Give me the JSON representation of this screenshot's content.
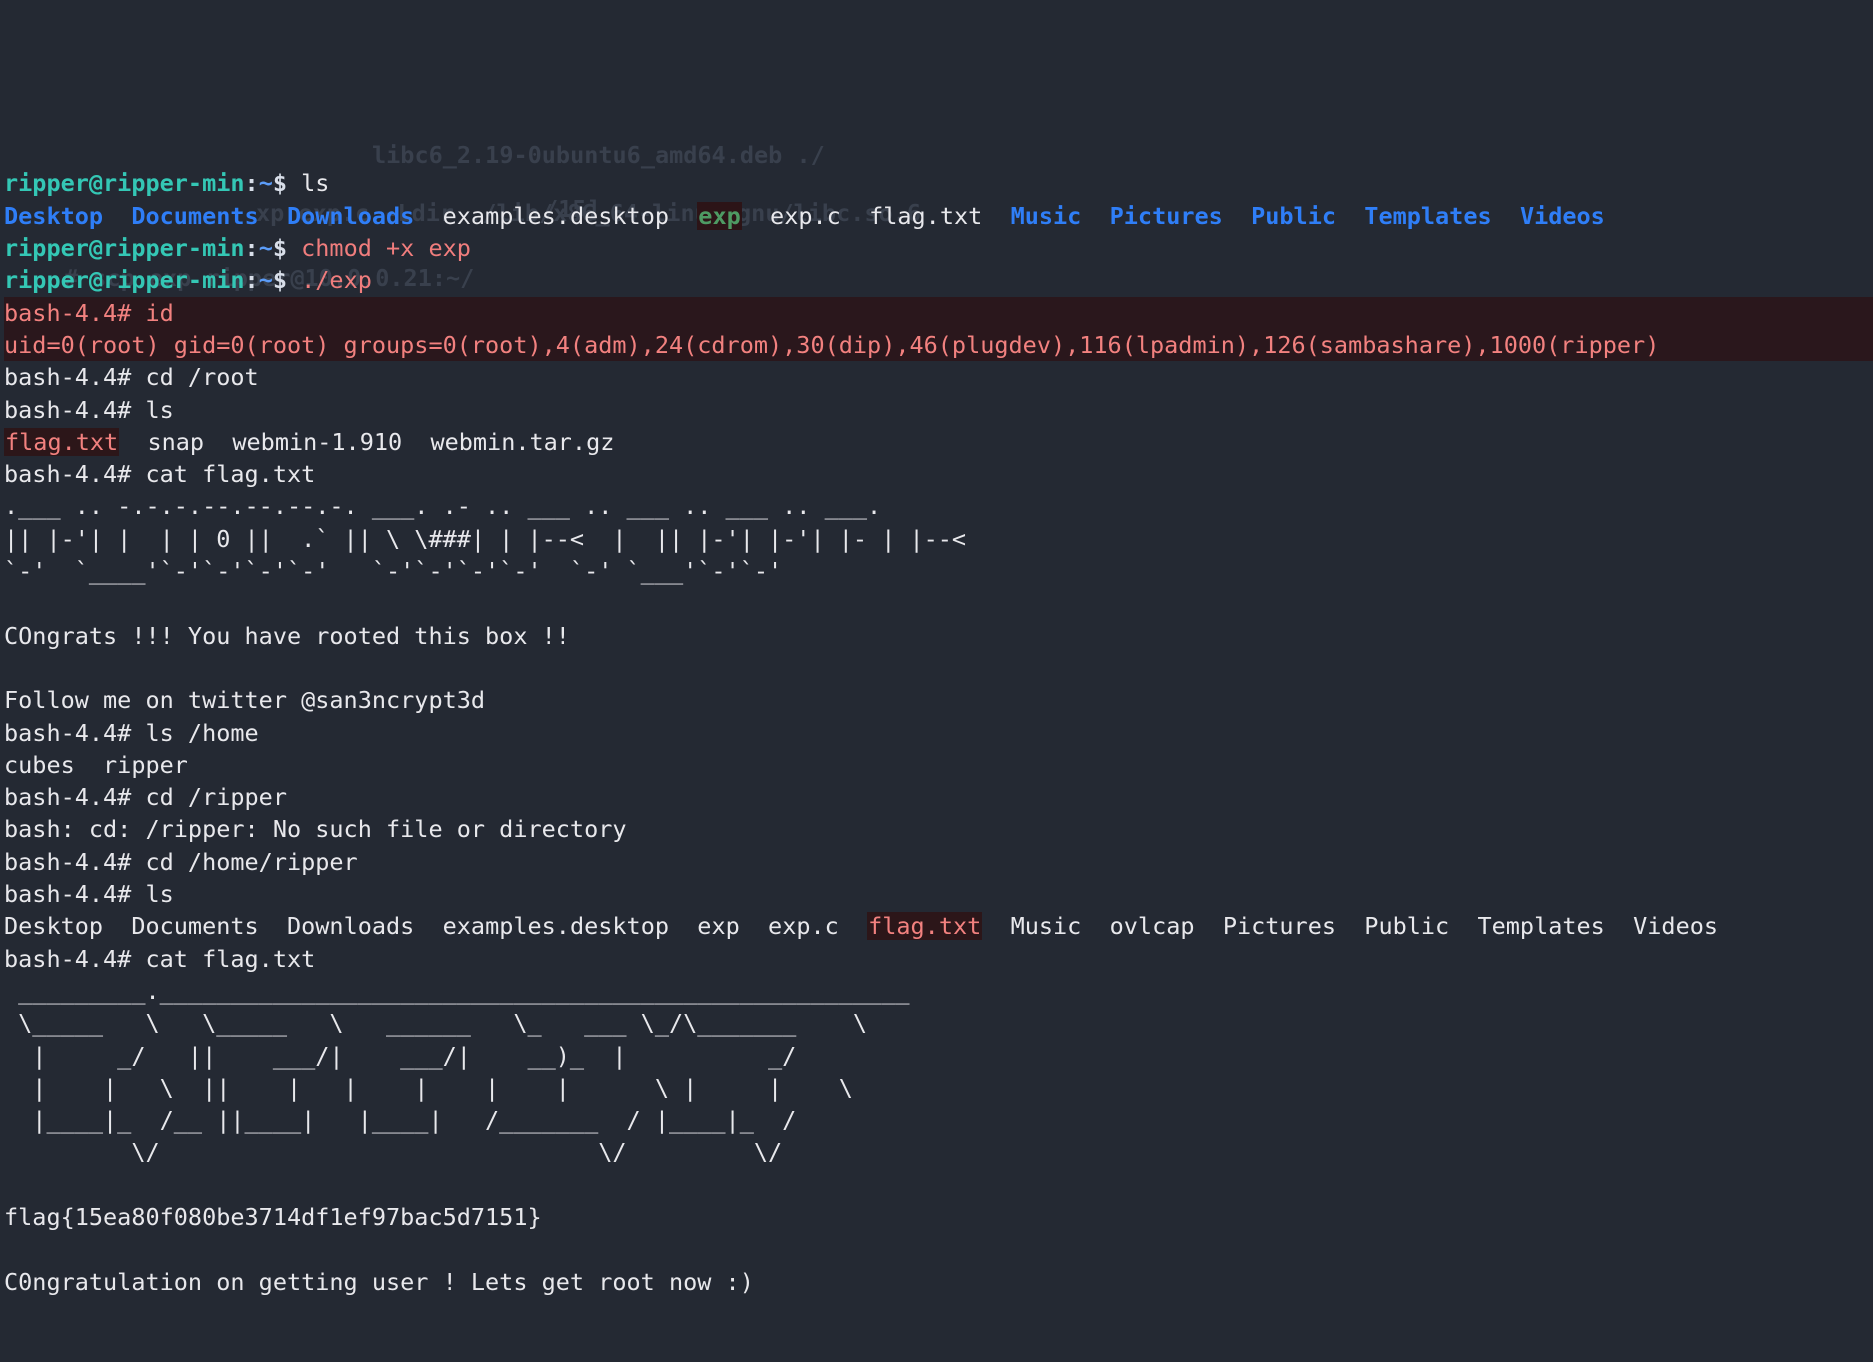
{
  "terminal": {
    "title": "ripper@ripper-min: ~",
    "colors": {
      "background": "#242933",
      "foreground": "#e8e8ec",
      "prompt_user": "#34c7b5",
      "prompt_path": "#5b9cf8",
      "directory": "#2f7ef7",
      "executable_fg": "#4e9a63",
      "executable_bg": "#2c1417",
      "archive_fg": "#f2817f",
      "archive_bg": "#2c1619",
      "root_block_bg": "#2a171c",
      "root_block_fg": "#f2817f",
      "ghost_text": "#39404d"
    },
    "prompts": {
      "user_prompt": "ripper@ripper-min",
      "user_path": "~",
      "user_sigil": "$",
      "root_prompt": "bash-4.4#"
    },
    "ghost_lines": [
      "",
      "libc6_2.19-0ubuntu6_amd64.deb ./",
      "",
      "/15]",
      "xp exp.c -Ldir ./lib/x86_64-linux-gnu/libc.so.6",
      "",
      "# scp exp ripper@10.0.0.21:~/",
      "0.0.21"
    ],
    "session": [
      {
        "type": "prompt-user",
        "command": "ls"
      },
      {
        "type": "ls-output",
        "entries": [
          {
            "name": "Desktop",
            "style": "dir"
          },
          {
            "name": "Documents",
            "style": "dir"
          },
          {
            "name": "Downloads",
            "style": "dir"
          },
          {
            "name": "examples.desktop",
            "style": "plain"
          },
          {
            "name": "exp",
            "style": "exe"
          },
          {
            "name": "exp.c",
            "style": "plain"
          },
          {
            "name": "flag.txt",
            "style": "plain"
          },
          {
            "name": "Music",
            "style": "dir"
          },
          {
            "name": "Pictures",
            "style": "dir"
          },
          {
            "name": "Public",
            "style": "dir"
          },
          {
            "name": "Templates",
            "style": "dir"
          },
          {
            "name": "Videos",
            "style": "dir"
          }
        ]
      },
      {
        "type": "prompt-user",
        "command": "chmod +x exp"
      },
      {
        "type": "prompt-user",
        "command": "./exp"
      },
      {
        "type": "root-cmd-hl",
        "command": "id"
      },
      {
        "type": "root-out-hl",
        "text": "uid=0(root) gid=0(root) groups=0(root),4(adm),24(cdrom),30(dip),46(plugdev),116(lpadmin),126(sambashare),1000(ripper)"
      },
      {
        "type": "root-cmd",
        "command": "cd /root"
      },
      {
        "type": "root-cmd",
        "command": "ls"
      },
      {
        "type": "ls-output",
        "entries": [
          {
            "name": "flag.txt",
            "style": "hl-file"
          },
          {
            "name": "snap",
            "style": "plain"
          },
          {
            "name": "webmin-1.910",
            "style": "plain"
          },
          {
            "name": "webmin.tar.gz",
            "style": "plain"
          }
        ]
      },
      {
        "type": "root-cmd",
        "command": "cat flag.txt"
      },
      {
        "type": "art",
        "lines": [
          ".___ .. -.-.-.--.--.--.-. ___. .- .. ___ .. ___ .. ___ .. ___.",
          "|| |-'| |  | | 0 ||  .` || \\ \\###| | |--<  |  || |-'| |-'| |- | |--<",
          "`-'  `____'`-'`-'`-'`-'   `-'`-'`-'`-'  `-' `___'`-'`-'"
        ]
      },
      {
        "type": "blank"
      },
      {
        "type": "plain",
        "text": "COngrats !!! You have rooted this box !!"
      },
      {
        "type": "blank"
      },
      {
        "type": "plain",
        "text": "Follow me on twitter @san3ncrypt3d"
      },
      {
        "type": "root-cmd",
        "command": "ls /home"
      },
      {
        "type": "plain",
        "text": "cubes  ripper"
      },
      {
        "type": "root-cmd",
        "command": "cd /ripper"
      },
      {
        "type": "plain",
        "text": "bash: cd: /ripper: No such file or directory"
      },
      {
        "type": "root-cmd",
        "command": "cd /home/ripper"
      },
      {
        "type": "root-cmd",
        "command": "ls"
      },
      {
        "type": "ls-output",
        "entries": [
          {
            "name": "Desktop",
            "style": "plain"
          },
          {
            "name": "Documents",
            "style": "plain"
          },
          {
            "name": "Downloads",
            "style": "plain"
          },
          {
            "name": "examples.desktop",
            "style": "plain"
          },
          {
            "name": "exp",
            "style": "plain"
          },
          {
            "name": "exp.c",
            "style": "plain"
          },
          {
            "name": "flag.txt",
            "style": "hl-file"
          },
          {
            "name": "Music",
            "style": "plain"
          },
          {
            "name": "ovlcap",
            "style": "plain"
          },
          {
            "name": "Pictures",
            "style": "plain"
          },
          {
            "name": "Public",
            "style": "plain"
          },
          {
            "name": "Templates",
            "style": "plain"
          },
          {
            "name": "Videos",
            "style": "plain"
          }
        ]
      },
      {
        "type": "root-cmd",
        "command": "cat flag.txt"
      },
      {
        "type": "art",
        "lines": [
          " _________._____________________________________________________",
          " \\_____   \\   \\_____   \\   ______   \\_   ___ \\_/\\_______    \\",
          "  |     _/   ||    ___/|    ___/|    __)_  |          _/",
          "  |    |   \\  ||    |   |    |    |    |      \\ |     |    \\",
          "  |____|_  /__ ||____|   |____|   /_______  / |____|_  /",
          "         \\/                               \\/         \\/"
        ]
      },
      {
        "type": "blank"
      },
      {
        "type": "plain",
        "text": "flag{15ea80f080be3714df1ef97bac5d7151}"
      },
      {
        "type": "blank"
      },
      {
        "type": "plain",
        "text": "C0ngratulation on getting user ! Lets get root now :)"
      }
    ],
    "flag_value": "flag{15ea80f080be3714df1ef97bac5d7151}",
    "twitter_handle": "@san3ncrypt3d",
    "congrats_root": "COngrats !!! You have rooted this box !!",
    "congrats_user": "C0ngratulation on getting user ! Lets get root now :)"
  }
}
